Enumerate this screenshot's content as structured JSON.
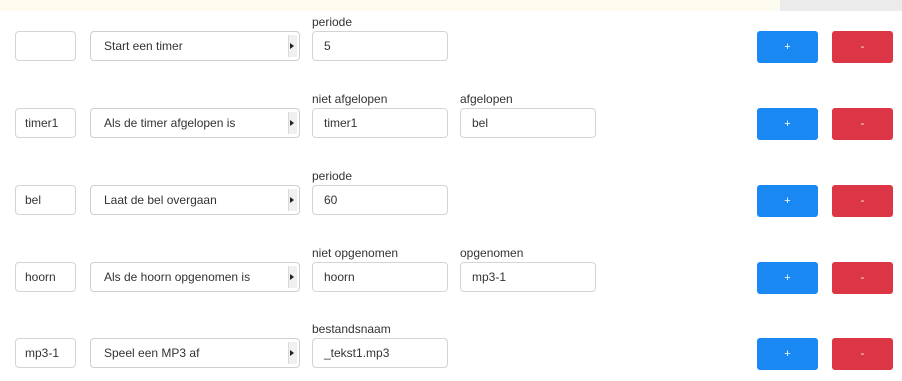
{
  "rows": [
    {
      "name": "",
      "action": "Start een timer",
      "param1": {
        "label": "periode",
        "value": "5"
      },
      "param2": null,
      "add_label": "+",
      "remove_label": "-"
    },
    {
      "name": "timer1",
      "action": "Als de timer afgelopen is",
      "param1": {
        "label": "niet afgelopen",
        "value": "timer1"
      },
      "param2": {
        "label": "afgelopen",
        "value": "bel"
      },
      "add_label": "+",
      "remove_label": "-"
    },
    {
      "name": "bel",
      "action": "Laat de bel overgaan",
      "param1": {
        "label": "periode",
        "value": "60"
      },
      "param2": null,
      "add_label": "+",
      "remove_label": "-"
    },
    {
      "name": "hoorn",
      "action": "Als de hoorn opgenomen is",
      "param1": {
        "label": "niet opgenomen",
        "value": "hoorn"
      },
      "param2": {
        "label": "opgenomen",
        "value": "mp3-1"
      },
      "add_label": "+",
      "remove_label": "-"
    },
    {
      "name": "mp3-1",
      "action": "Speel een MP3 af",
      "param1": {
        "label": "bestandsnaam",
        "value": "_tekst1.mp3"
      },
      "param2": null,
      "add_label": "+",
      "remove_label": "-"
    }
  ],
  "colors": {
    "add": "#1a88f2",
    "remove": "#dc3545",
    "border": "#d4d4d4"
  }
}
